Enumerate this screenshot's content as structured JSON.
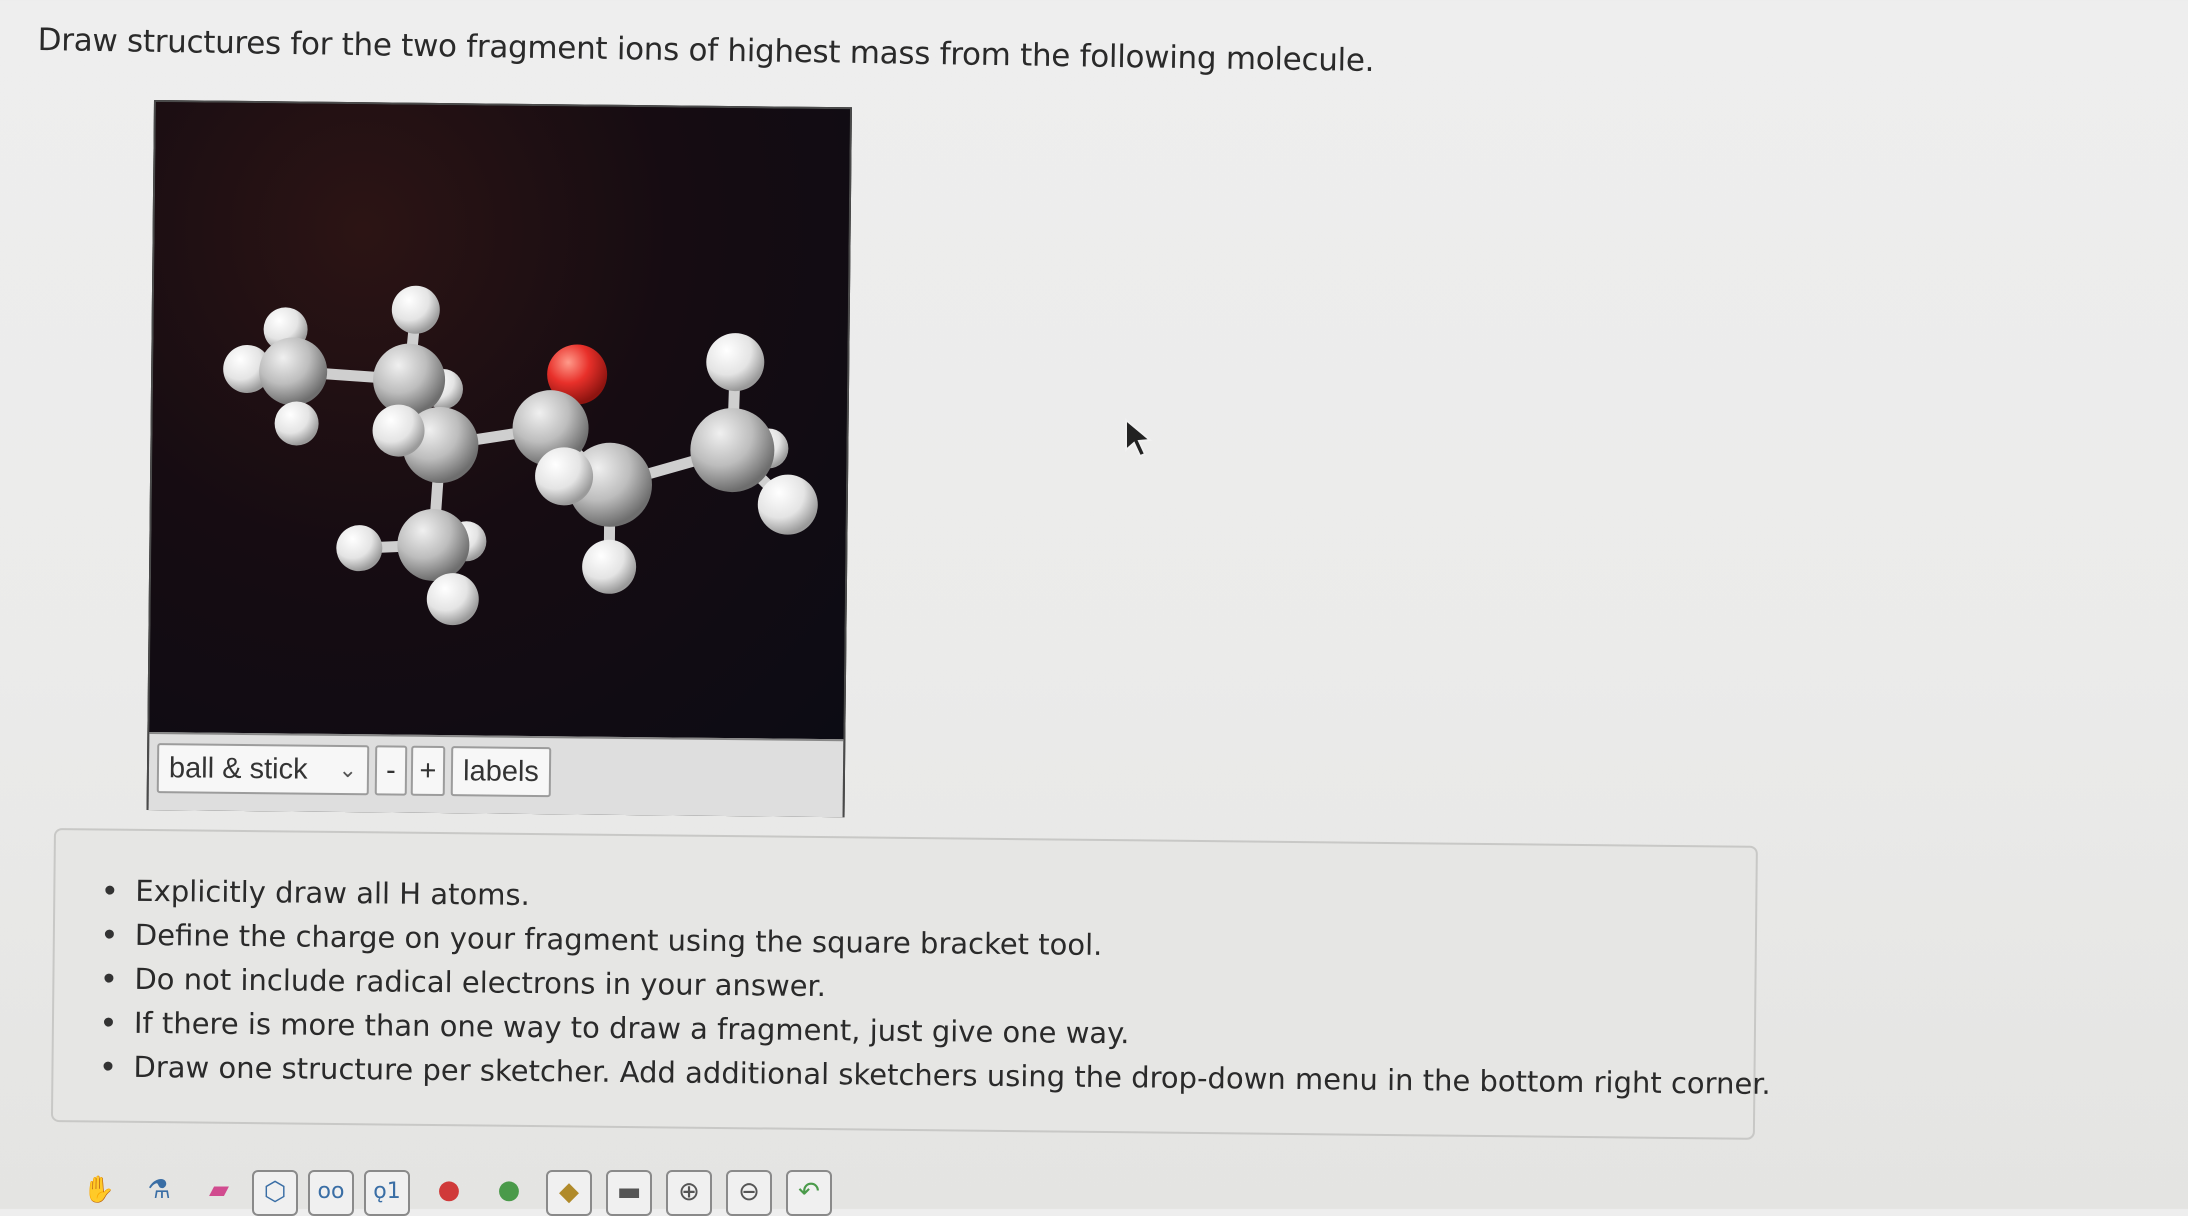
{
  "question": "Draw structures for the two fragment ions of highest mass from the following molecule.",
  "viewer": {
    "style_selected": "ball & stick",
    "zoom_out_label": "-",
    "zoom_in_label": "+",
    "labels_button": "labels"
  },
  "instructions": [
    "Explicitly draw all H atoms.",
    "Define the charge on your fragment using the square bracket tool.",
    "Do not include radical electrons in your answer.",
    "If there is more than one way to draw a fragment, just give one way.",
    "Draw one structure per sketcher. Add additional sketchers using the drop-down menu in the bottom right corner."
  ],
  "colors": {
    "oxygen": "#e8302a",
    "carbon": "#b8b8b8",
    "hydrogen": "#ededed",
    "background": "#120c14"
  },
  "toolbar_icons": [
    "hand-icon",
    "bottle-icon",
    "eraser-icon",
    "ring-icon",
    "chain-icon",
    "atom-icon",
    "red-tool-icon",
    "green-tool-icon",
    "tool-icon",
    "tool-icon",
    "tool-icon",
    "tool-icon",
    "tool-icon"
  ]
}
